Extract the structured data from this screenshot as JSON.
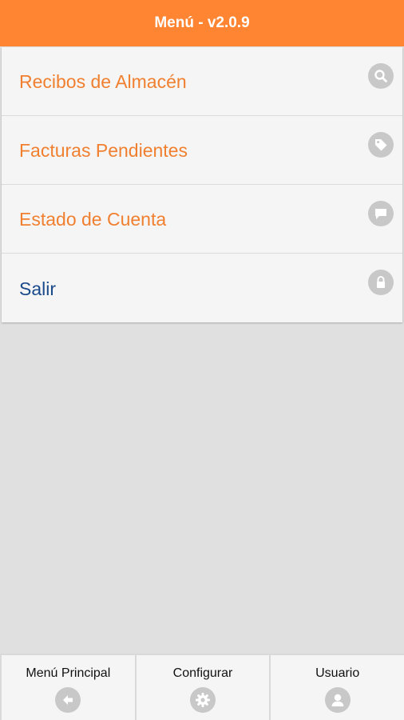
{
  "header": {
    "title": "Menú - v2.0.9"
  },
  "menu": {
    "items": [
      {
        "label": "Recibos de Almacén",
        "icon": "search-icon"
      },
      {
        "label": "Facturas Pendientes",
        "icon": "tag-icon"
      },
      {
        "label": "Estado de Cuenta",
        "icon": "chat-bubble-icon"
      },
      {
        "label": "Salir",
        "icon": "lock-icon"
      }
    ]
  },
  "tabbar": {
    "tabs": [
      {
        "label": "Menú Principal",
        "icon": "arrow-left-icon"
      },
      {
        "label": "Configurar",
        "icon": "gear-icon"
      },
      {
        "label": "Usuario",
        "icon": "user-icon"
      }
    ]
  },
  "colors": {
    "header_bg": "#ff8533",
    "menu_text": "#f08030",
    "exit_text": "#1a4a8a",
    "icon_bg": "#c8c8c8",
    "page_bg": "#e0e0e0"
  }
}
